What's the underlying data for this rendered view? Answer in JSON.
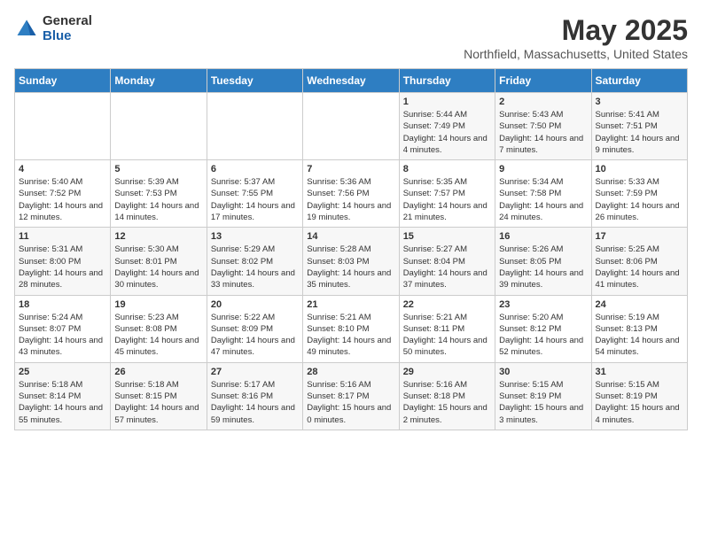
{
  "header": {
    "logo_general": "General",
    "logo_blue": "Blue",
    "month": "May 2025",
    "location": "Northfield, Massachusetts, United States"
  },
  "weekdays": [
    "Sunday",
    "Monday",
    "Tuesday",
    "Wednesday",
    "Thursday",
    "Friday",
    "Saturday"
  ],
  "weeks": [
    [
      {
        "day": "",
        "info": ""
      },
      {
        "day": "",
        "info": ""
      },
      {
        "day": "",
        "info": ""
      },
      {
        "day": "",
        "info": ""
      },
      {
        "day": "1",
        "info": "Sunrise: 5:44 AM\nSunset: 7:49 PM\nDaylight: 14 hours\nand 4 minutes."
      },
      {
        "day": "2",
        "info": "Sunrise: 5:43 AM\nSunset: 7:50 PM\nDaylight: 14 hours\nand 7 minutes."
      },
      {
        "day": "3",
        "info": "Sunrise: 5:41 AM\nSunset: 7:51 PM\nDaylight: 14 hours\nand 9 minutes."
      }
    ],
    [
      {
        "day": "4",
        "info": "Sunrise: 5:40 AM\nSunset: 7:52 PM\nDaylight: 14 hours\nand 12 minutes."
      },
      {
        "day": "5",
        "info": "Sunrise: 5:39 AM\nSunset: 7:53 PM\nDaylight: 14 hours\nand 14 minutes."
      },
      {
        "day": "6",
        "info": "Sunrise: 5:37 AM\nSunset: 7:55 PM\nDaylight: 14 hours\nand 17 minutes."
      },
      {
        "day": "7",
        "info": "Sunrise: 5:36 AM\nSunset: 7:56 PM\nDaylight: 14 hours\nand 19 minutes."
      },
      {
        "day": "8",
        "info": "Sunrise: 5:35 AM\nSunset: 7:57 PM\nDaylight: 14 hours\nand 21 minutes."
      },
      {
        "day": "9",
        "info": "Sunrise: 5:34 AM\nSunset: 7:58 PM\nDaylight: 14 hours\nand 24 minutes."
      },
      {
        "day": "10",
        "info": "Sunrise: 5:33 AM\nSunset: 7:59 PM\nDaylight: 14 hours\nand 26 minutes."
      }
    ],
    [
      {
        "day": "11",
        "info": "Sunrise: 5:31 AM\nSunset: 8:00 PM\nDaylight: 14 hours\nand 28 minutes."
      },
      {
        "day": "12",
        "info": "Sunrise: 5:30 AM\nSunset: 8:01 PM\nDaylight: 14 hours\nand 30 minutes."
      },
      {
        "day": "13",
        "info": "Sunrise: 5:29 AM\nSunset: 8:02 PM\nDaylight: 14 hours\nand 33 minutes."
      },
      {
        "day": "14",
        "info": "Sunrise: 5:28 AM\nSunset: 8:03 PM\nDaylight: 14 hours\nand 35 minutes."
      },
      {
        "day": "15",
        "info": "Sunrise: 5:27 AM\nSunset: 8:04 PM\nDaylight: 14 hours\nand 37 minutes."
      },
      {
        "day": "16",
        "info": "Sunrise: 5:26 AM\nSunset: 8:05 PM\nDaylight: 14 hours\nand 39 minutes."
      },
      {
        "day": "17",
        "info": "Sunrise: 5:25 AM\nSunset: 8:06 PM\nDaylight: 14 hours\nand 41 minutes."
      }
    ],
    [
      {
        "day": "18",
        "info": "Sunrise: 5:24 AM\nSunset: 8:07 PM\nDaylight: 14 hours\nand 43 minutes."
      },
      {
        "day": "19",
        "info": "Sunrise: 5:23 AM\nSunset: 8:08 PM\nDaylight: 14 hours\nand 45 minutes."
      },
      {
        "day": "20",
        "info": "Sunrise: 5:22 AM\nSunset: 8:09 PM\nDaylight: 14 hours\nand 47 minutes."
      },
      {
        "day": "21",
        "info": "Sunrise: 5:21 AM\nSunset: 8:10 PM\nDaylight: 14 hours\nand 49 minutes."
      },
      {
        "day": "22",
        "info": "Sunrise: 5:21 AM\nSunset: 8:11 PM\nDaylight: 14 hours\nand 50 minutes."
      },
      {
        "day": "23",
        "info": "Sunrise: 5:20 AM\nSunset: 8:12 PM\nDaylight: 14 hours\nand 52 minutes."
      },
      {
        "day": "24",
        "info": "Sunrise: 5:19 AM\nSunset: 8:13 PM\nDaylight: 14 hours\nand 54 minutes."
      }
    ],
    [
      {
        "day": "25",
        "info": "Sunrise: 5:18 AM\nSunset: 8:14 PM\nDaylight: 14 hours\nand 55 minutes."
      },
      {
        "day": "26",
        "info": "Sunrise: 5:18 AM\nSunset: 8:15 PM\nDaylight: 14 hours\nand 57 minutes."
      },
      {
        "day": "27",
        "info": "Sunrise: 5:17 AM\nSunset: 8:16 PM\nDaylight: 14 hours\nand 59 minutes."
      },
      {
        "day": "28",
        "info": "Sunrise: 5:16 AM\nSunset: 8:17 PM\nDaylight: 15 hours\nand 0 minutes."
      },
      {
        "day": "29",
        "info": "Sunrise: 5:16 AM\nSunset: 8:18 PM\nDaylight: 15 hours\nand 2 minutes."
      },
      {
        "day": "30",
        "info": "Sunrise: 5:15 AM\nSunset: 8:19 PM\nDaylight: 15 hours\nand 3 minutes."
      },
      {
        "day": "31",
        "info": "Sunrise: 5:15 AM\nSunset: 8:19 PM\nDaylight: 15 hours\nand 4 minutes."
      }
    ]
  ]
}
